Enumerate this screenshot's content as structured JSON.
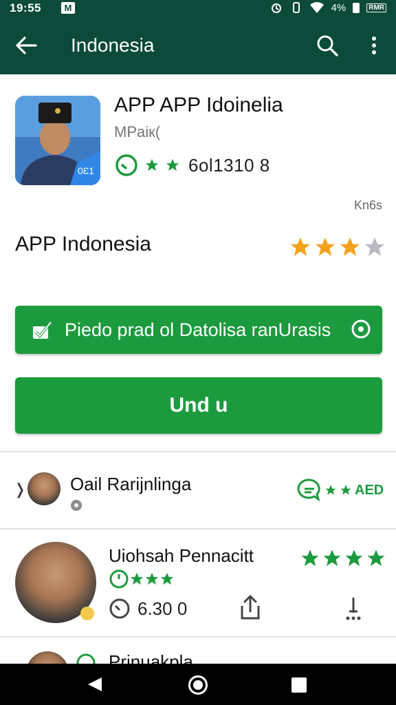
{
  "status_bar": {
    "time": "19:55",
    "notification_icon": "gmail-icon",
    "battery_percent": "4%",
    "badge": "RMR"
  },
  "app_bar": {
    "title": "Indonesia",
    "back_icon": "arrow-left-icon",
    "search_icon": "search-icon",
    "more_icon": "more-vert-icon"
  },
  "app": {
    "name": "APP APP Idoinelia",
    "developer": "MPaiк(",
    "rating_count": "6ol1310 8",
    "icon_badge": "0Ɛ1",
    "kinds_label": "Kn6s"
  },
  "section": {
    "title": "APP Indonesia",
    "rating": 3.5,
    "star_color": "#f4a11e",
    "star_empty_color": "#b9b9c4"
  },
  "buttons": {
    "primary_label": "Piedo prad ol Datolisa ranUrasis",
    "install_label": "Und u",
    "accent": "#1c9b3e"
  },
  "reviews": [
    {
      "name": "Oail Rarijnlinga",
      "badge": "AED"
    },
    {
      "name": "Uiohsah Pennacitt",
      "stars": 4,
      "sub_stars": 3,
      "count": "6.30 0"
    },
    {
      "name": "Prinuakpla"
    }
  ],
  "nav_bar": {
    "back": "nav-back-icon",
    "home": "nav-home-icon",
    "recents": "nav-recents-icon"
  }
}
